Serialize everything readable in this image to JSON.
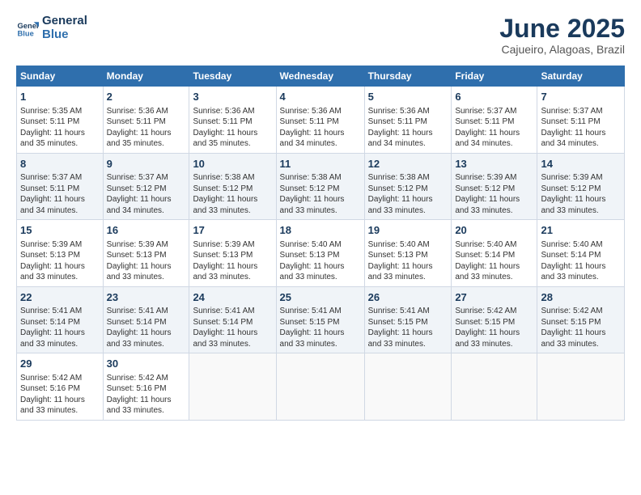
{
  "logo": {
    "line1": "General",
    "line2": "Blue"
  },
  "title": "June 2025",
  "location": "Cajueiro, Alagoas, Brazil",
  "days_of_week": [
    "Sunday",
    "Monday",
    "Tuesday",
    "Wednesday",
    "Thursday",
    "Friday",
    "Saturday"
  ],
  "weeks": [
    [
      {
        "day": 1,
        "lines": [
          "Sunrise: 5:35 AM",
          "Sunset: 5:11 PM",
          "Daylight: 11 hours",
          "and 35 minutes."
        ]
      },
      {
        "day": 2,
        "lines": [
          "Sunrise: 5:36 AM",
          "Sunset: 5:11 PM",
          "Daylight: 11 hours",
          "and 35 minutes."
        ]
      },
      {
        "day": 3,
        "lines": [
          "Sunrise: 5:36 AM",
          "Sunset: 5:11 PM",
          "Daylight: 11 hours",
          "and 35 minutes."
        ]
      },
      {
        "day": 4,
        "lines": [
          "Sunrise: 5:36 AM",
          "Sunset: 5:11 PM",
          "Daylight: 11 hours",
          "and 34 minutes."
        ]
      },
      {
        "day": 5,
        "lines": [
          "Sunrise: 5:36 AM",
          "Sunset: 5:11 PM",
          "Daylight: 11 hours",
          "and 34 minutes."
        ]
      },
      {
        "day": 6,
        "lines": [
          "Sunrise: 5:37 AM",
          "Sunset: 5:11 PM",
          "Daylight: 11 hours",
          "and 34 minutes."
        ]
      },
      {
        "day": 7,
        "lines": [
          "Sunrise: 5:37 AM",
          "Sunset: 5:11 PM",
          "Daylight: 11 hours",
          "and 34 minutes."
        ]
      }
    ],
    [
      {
        "day": 8,
        "lines": [
          "Sunrise: 5:37 AM",
          "Sunset: 5:11 PM",
          "Daylight: 11 hours",
          "and 34 minutes."
        ]
      },
      {
        "day": 9,
        "lines": [
          "Sunrise: 5:37 AM",
          "Sunset: 5:12 PM",
          "Daylight: 11 hours",
          "and 34 minutes."
        ]
      },
      {
        "day": 10,
        "lines": [
          "Sunrise: 5:38 AM",
          "Sunset: 5:12 PM",
          "Daylight: 11 hours",
          "and 33 minutes."
        ]
      },
      {
        "day": 11,
        "lines": [
          "Sunrise: 5:38 AM",
          "Sunset: 5:12 PM",
          "Daylight: 11 hours",
          "and 33 minutes."
        ]
      },
      {
        "day": 12,
        "lines": [
          "Sunrise: 5:38 AM",
          "Sunset: 5:12 PM",
          "Daylight: 11 hours",
          "and 33 minutes."
        ]
      },
      {
        "day": 13,
        "lines": [
          "Sunrise: 5:39 AM",
          "Sunset: 5:12 PM",
          "Daylight: 11 hours",
          "and 33 minutes."
        ]
      },
      {
        "day": 14,
        "lines": [
          "Sunrise: 5:39 AM",
          "Sunset: 5:12 PM",
          "Daylight: 11 hours",
          "and 33 minutes."
        ]
      }
    ],
    [
      {
        "day": 15,
        "lines": [
          "Sunrise: 5:39 AM",
          "Sunset: 5:13 PM",
          "Daylight: 11 hours",
          "and 33 minutes."
        ]
      },
      {
        "day": 16,
        "lines": [
          "Sunrise: 5:39 AM",
          "Sunset: 5:13 PM",
          "Daylight: 11 hours",
          "and 33 minutes."
        ]
      },
      {
        "day": 17,
        "lines": [
          "Sunrise: 5:39 AM",
          "Sunset: 5:13 PM",
          "Daylight: 11 hours",
          "and 33 minutes."
        ]
      },
      {
        "day": 18,
        "lines": [
          "Sunrise: 5:40 AM",
          "Sunset: 5:13 PM",
          "Daylight: 11 hours",
          "and 33 minutes."
        ]
      },
      {
        "day": 19,
        "lines": [
          "Sunrise: 5:40 AM",
          "Sunset: 5:13 PM",
          "Daylight: 11 hours",
          "and 33 minutes."
        ]
      },
      {
        "day": 20,
        "lines": [
          "Sunrise: 5:40 AM",
          "Sunset: 5:14 PM",
          "Daylight: 11 hours",
          "and 33 minutes."
        ]
      },
      {
        "day": 21,
        "lines": [
          "Sunrise: 5:40 AM",
          "Sunset: 5:14 PM",
          "Daylight: 11 hours",
          "and 33 minutes."
        ]
      }
    ],
    [
      {
        "day": 22,
        "lines": [
          "Sunrise: 5:41 AM",
          "Sunset: 5:14 PM",
          "Daylight: 11 hours",
          "and 33 minutes."
        ]
      },
      {
        "day": 23,
        "lines": [
          "Sunrise: 5:41 AM",
          "Sunset: 5:14 PM",
          "Daylight: 11 hours",
          "and 33 minutes."
        ]
      },
      {
        "day": 24,
        "lines": [
          "Sunrise: 5:41 AM",
          "Sunset: 5:14 PM",
          "Daylight: 11 hours",
          "and 33 minutes."
        ]
      },
      {
        "day": 25,
        "lines": [
          "Sunrise: 5:41 AM",
          "Sunset: 5:15 PM",
          "Daylight: 11 hours",
          "and 33 minutes."
        ]
      },
      {
        "day": 26,
        "lines": [
          "Sunrise: 5:41 AM",
          "Sunset: 5:15 PM",
          "Daylight: 11 hours",
          "and 33 minutes."
        ]
      },
      {
        "day": 27,
        "lines": [
          "Sunrise: 5:42 AM",
          "Sunset: 5:15 PM",
          "Daylight: 11 hours",
          "and 33 minutes."
        ]
      },
      {
        "day": 28,
        "lines": [
          "Sunrise: 5:42 AM",
          "Sunset: 5:15 PM",
          "Daylight: 11 hours",
          "and 33 minutes."
        ]
      }
    ],
    [
      {
        "day": 29,
        "lines": [
          "Sunrise: 5:42 AM",
          "Sunset: 5:16 PM",
          "Daylight: 11 hours",
          "and 33 minutes."
        ]
      },
      {
        "day": 30,
        "lines": [
          "Sunrise: 5:42 AM",
          "Sunset: 5:16 PM",
          "Daylight: 11 hours",
          "and 33 minutes."
        ]
      },
      null,
      null,
      null,
      null,
      null
    ]
  ]
}
